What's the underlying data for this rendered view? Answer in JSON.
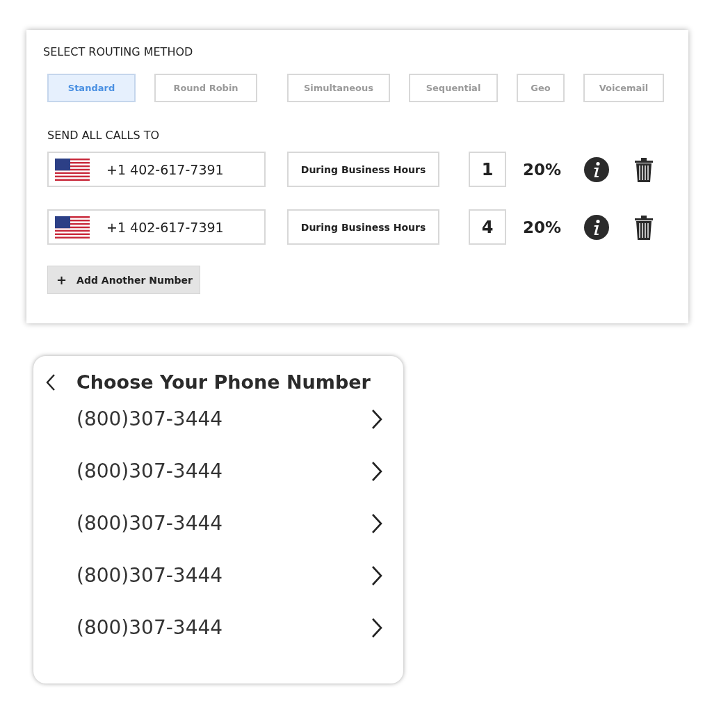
{
  "routing": {
    "title": "SELECT ROUTING METHOD",
    "methods": [
      {
        "label": "Standard",
        "selected": true
      },
      {
        "label": "Round Robin",
        "selected": false
      },
      {
        "label": "Simultaneous",
        "selected": false
      },
      {
        "label": "Sequential",
        "selected": false
      },
      {
        "label": "Geo",
        "selected": false
      },
      {
        "label": "Voicemail",
        "selected": false
      }
    ],
    "destinations_title": "SEND ALL CALLS TO",
    "destinations": [
      {
        "phone": "+1 402-617-7391",
        "schedule": "During Business Hours",
        "priority": "1",
        "percent": "20%"
      },
      {
        "phone": "+1 402-617-7391",
        "schedule": "During Business Hours",
        "priority": "4",
        "percent": "20%"
      }
    ],
    "add_button": {
      "icon": "+",
      "label": "Add Another Number"
    }
  },
  "chooser": {
    "title": "Choose Your Phone Number",
    "numbers": [
      "(800)307-3444",
      "(800)307-3444",
      "(800)307-3444",
      "(800)307-3444",
      "(800)307-3444"
    ]
  }
}
